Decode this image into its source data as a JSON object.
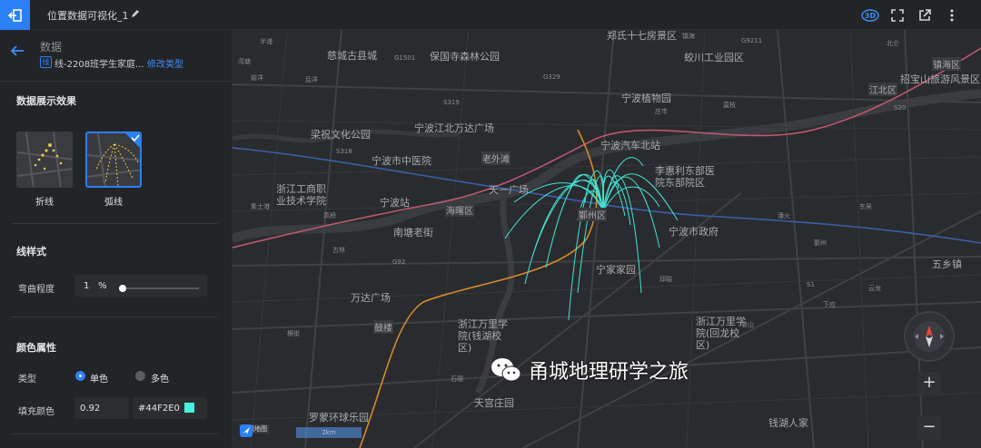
{
  "toolbar": {
    "title": "位置数据可视化_1",
    "icons": [
      "exit-icon",
      "edit-icon",
      "3d-icon",
      "fullscreen-icon",
      "share-icon",
      "more-icon"
    ],
    "label_3d": "3D"
  },
  "sidebar": {
    "section_title": "数据",
    "dataset_badge": "线",
    "dataset_name": "线-2208班学生家庭...",
    "change_type": "修改类型",
    "effect_title": "数据展示效果",
    "styles": [
      {
        "label": "折线",
        "selected": false
      },
      {
        "label": "弧线",
        "selected": true
      }
    ],
    "line_style_title": "线样式",
    "curvature_label": "弯曲程度",
    "curvature_value": "1",
    "curvature_unit": "%",
    "color_title": "颜色属性",
    "type_label": "类型",
    "type_single": "单色",
    "type_multi": "多色",
    "fill_color_label": "填充颜色",
    "fill_opacity": "0.92",
    "fill_color_hex": "#44F2E0"
  },
  "colors": {
    "accent": "#2b80f5",
    "arc": "#44F2E0",
    "metro_orange": "#d08a2e",
    "metro_blue": "#3b5ea8",
    "metro_pink": "#b9586f"
  },
  "map": {
    "labels_big": [
      "宁波江北万达广场",
      "宁波汽车北站",
      "宁波市中医院",
      "梁祝文化公园",
      "浙江工商职业技术学院",
      "李惠利东部医院东部院区",
      "宁波站",
      "南塘老街",
      "宁波市政府",
      "宁家家园",
      "万达广场",
      "浙江万里学院(钱湖校区)",
      "浙江万里学院(回龙校区)",
      "天宫庄园",
      "宁波植物园",
      "罗蒙环球乐园",
      "郑氏十七房景区",
      "蛟川工业园区",
      "保国寺森林公园",
      "慈城古县城",
      "招宝山旅游风景区",
      "天一广场",
      "五乡镇",
      "钱湖人家"
    ],
    "labels_small": [
      "湾塘",
      "半浦",
      "前洋",
      "后洋",
      "鄞州",
      "北仑",
      "东吴",
      "潘火",
      "下应",
      "云龙",
      "莫枝",
      "镇海",
      "庄市",
      "姜山",
      "高桥",
      "古林",
      "集士港",
      "横街",
      "石碶",
      "邱隘"
    ],
    "road_labels": [
      "G1501",
      "S319",
      "G329",
      "S318",
      "G92",
      "S1",
      "S20",
      "G9211"
    ],
    "stations": [
      "老外滩",
      "鼓楼",
      "海曙区",
      "鄞州区",
      "江北区",
      "镇海区"
    ],
    "scale_text": "2km",
    "logo_text": "高德地图"
  },
  "watermark": {
    "text": "甬城地理研学之旅"
  },
  "controls": {
    "zoom_in": "+",
    "zoom_out": "−"
  }
}
